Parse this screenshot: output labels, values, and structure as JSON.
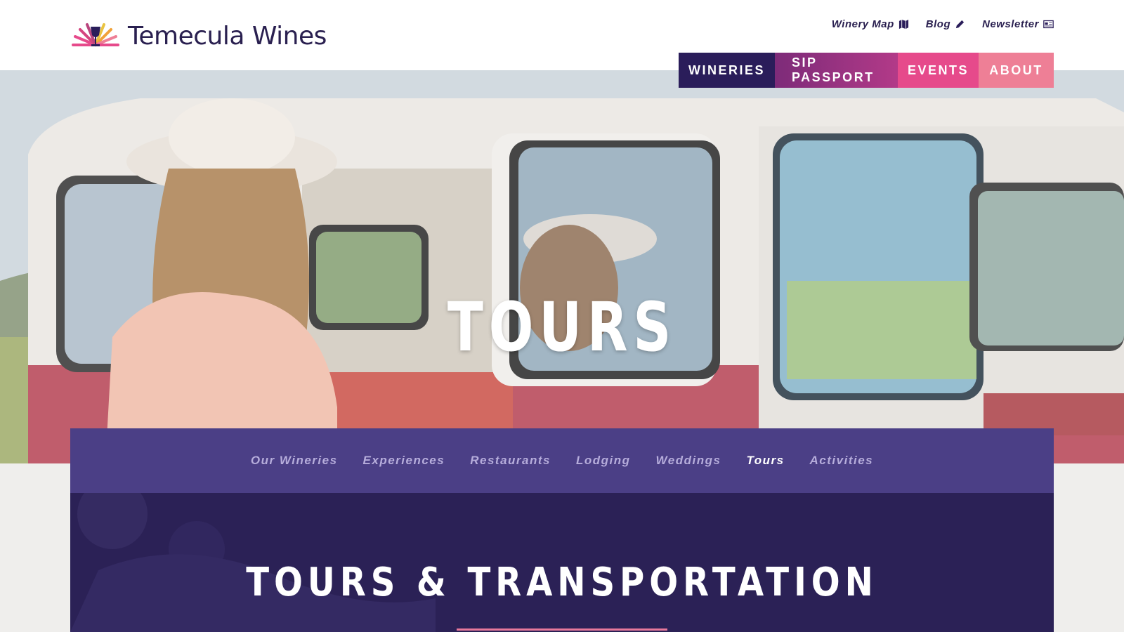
{
  "brand": {
    "name": "Temecula Wines",
    "colors": {
      "navy": "#2a1d5a",
      "plum": "#8c2f7f",
      "pink": "#e64a8b",
      "rose": "#ee7f96",
      "purple": "#4b3f86",
      "deep_purple": "#2b2156"
    }
  },
  "utility_nav": [
    {
      "label": "Winery Map",
      "icon": "map-icon"
    },
    {
      "label": "Blog",
      "icon": "pencil-icon"
    },
    {
      "label": "Newsletter",
      "icon": "newspaper-icon"
    }
  ],
  "main_nav": [
    {
      "label": "WINERIES"
    },
    {
      "label": "SIP PASSPORT"
    },
    {
      "label": "EVENTS"
    },
    {
      "label": "ABOUT"
    }
  ],
  "hero": {
    "title": "TOURS"
  },
  "sub_nav": {
    "items": [
      "Our Wineries",
      "Experiences",
      "Restaurants",
      "Lodging",
      "Weddings",
      "Tours",
      "Activities"
    ],
    "active": "Tours"
  },
  "section": {
    "title": "TOURS & TRANSPORTATION"
  }
}
